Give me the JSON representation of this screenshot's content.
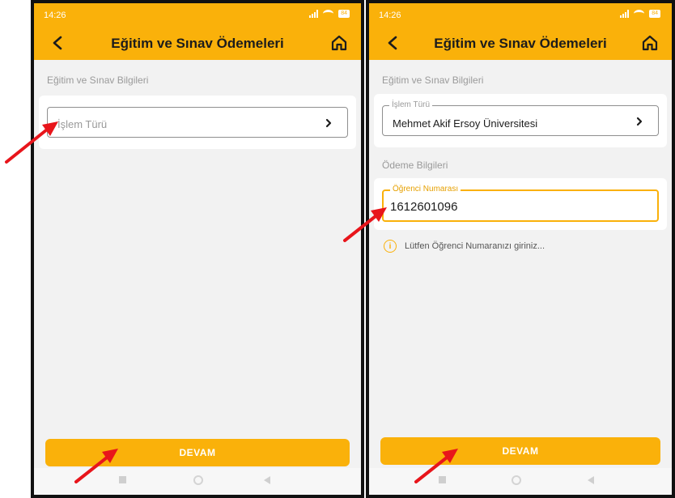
{
  "status": {
    "time": "14:26",
    "battery": "84"
  },
  "appbar": {
    "title": "Eğitim ve Sınav Ödemeleri"
  },
  "left": {
    "section_label": "Eğitim ve Sınav Bilgileri",
    "islem_turu_placeholder": "İşlem Türü",
    "devam_label": "DEVAM"
  },
  "right": {
    "section_label": "Eğitim ve Sınav Bilgileri",
    "islem_turu_legend": "İşlem Türü",
    "islem_turu_value": "Mehmet Akif Ersoy Üniversitesi",
    "payment_section_label": "Ödeme Bilgileri",
    "student_number_legend": "Öğrenci Numarası",
    "student_number_value": "1612601096",
    "info_text": "Lütfen Öğrenci Numaranızı giriniz...",
    "devam_label": "DEVAM"
  },
  "icons": {
    "back": "back-chevron-icon",
    "home": "home-icon",
    "chevron": "chevron-right-icon",
    "info": "info-icon",
    "annotation": "red-arrow-icon"
  },
  "colors": {
    "accent": "#fab10a",
    "arrow": "#e8151b",
    "background": "#f2f2f2"
  }
}
